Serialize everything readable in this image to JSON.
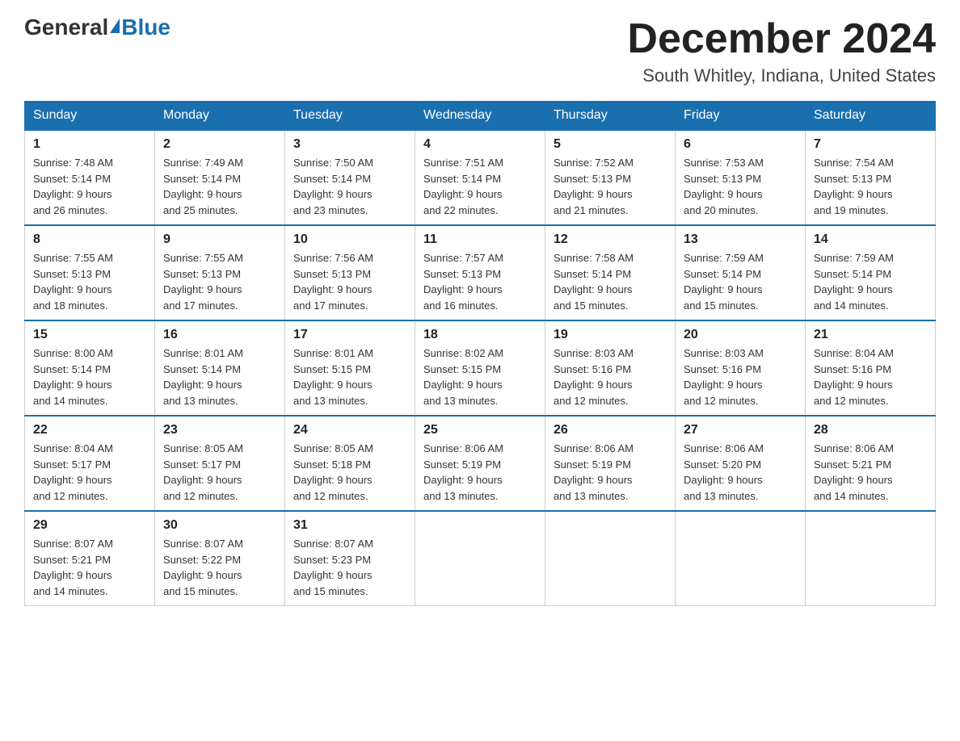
{
  "header": {
    "logo_general": "General",
    "logo_blue": "Blue",
    "month_title": "December 2024",
    "location": "South Whitley, Indiana, United States"
  },
  "days_of_week": [
    "Sunday",
    "Monday",
    "Tuesday",
    "Wednesday",
    "Thursday",
    "Friday",
    "Saturday"
  ],
  "weeks": [
    [
      {
        "day": "1",
        "sunrise": "7:48 AM",
        "sunset": "5:14 PM",
        "daylight": "9 hours and 26 minutes."
      },
      {
        "day": "2",
        "sunrise": "7:49 AM",
        "sunset": "5:14 PM",
        "daylight": "9 hours and 25 minutes."
      },
      {
        "day": "3",
        "sunrise": "7:50 AM",
        "sunset": "5:14 PM",
        "daylight": "9 hours and 23 minutes."
      },
      {
        "day": "4",
        "sunrise": "7:51 AM",
        "sunset": "5:14 PM",
        "daylight": "9 hours and 22 minutes."
      },
      {
        "day": "5",
        "sunrise": "7:52 AM",
        "sunset": "5:13 PM",
        "daylight": "9 hours and 21 minutes."
      },
      {
        "day": "6",
        "sunrise": "7:53 AM",
        "sunset": "5:13 PM",
        "daylight": "9 hours and 20 minutes."
      },
      {
        "day": "7",
        "sunrise": "7:54 AM",
        "sunset": "5:13 PM",
        "daylight": "9 hours and 19 minutes."
      }
    ],
    [
      {
        "day": "8",
        "sunrise": "7:55 AM",
        "sunset": "5:13 PM",
        "daylight": "9 hours and 18 minutes."
      },
      {
        "day": "9",
        "sunrise": "7:55 AM",
        "sunset": "5:13 PM",
        "daylight": "9 hours and 17 minutes."
      },
      {
        "day": "10",
        "sunrise": "7:56 AM",
        "sunset": "5:13 PM",
        "daylight": "9 hours and 17 minutes."
      },
      {
        "day": "11",
        "sunrise": "7:57 AM",
        "sunset": "5:13 PM",
        "daylight": "9 hours and 16 minutes."
      },
      {
        "day": "12",
        "sunrise": "7:58 AM",
        "sunset": "5:14 PM",
        "daylight": "9 hours and 15 minutes."
      },
      {
        "day": "13",
        "sunrise": "7:59 AM",
        "sunset": "5:14 PM",
        "daylight": "9 hours and 15 minutes."
      },
      {
        "day": "14",
        "sunrise": "7:59 AM",
        "sunset": "5:14 PM",
        "daylight": "9 hours and 14 minutes."
      }
    ],
    [
      {
        "day": "15",
        "sunrise": "8:00 AM",
        "sunset": "5:14 PM",
        "daylight": "9 hours and 14 minutes."
      },
      {
        "day": "16",
        "sunrise": "8:01 AM",
        "sunset": "5:14 PM",
        "daylight": "9 hours and 13 minutes."
      },
      {
        "day": "17",
        "sunrise": "8:01 AM",
        "sunset": "5:15 PM",
        "daylight": "9 hours and 13 minutes."
      },
      {
        "day": "18",
        "sunrise": "8:02 AM",
        "sunset": "5:15 PM",
        "daylight": "9 hours and 13 minutes."
      },
      {
        "day": "19",
        "sunrise": "8:03 AM",
        "sunset": "5:16 PM",
        "daylight": "9 hours and 12 minutes."
      },
      {
        "day": "20",
        "sunrise": "8:03 AM",
        "sunset": "5:16 PM",
        "daylight": "9 hours and 12 minutes."
      },
      {
        "day": "21",
        "sunrise": "8:04 AM",
        "sunset": "5:16 PM",
        "daylight": "9 hours and 12 minutes."
      }
    ],
    [
      {
        "day": "22",
        "sunrise": "8:04 AM",
        "sunset": "5:17 PM",
        "daylight": "9 hours and 12 minutes."
      },
      {
        "day": "23",
        "sunrise": "8:05 AM",
        "sunset": "5:17 PM",
        "daylight": "9 hours and 12 minutes."
      },
      {
        "day": "24",
        "sunrise": "8:05 AM",
        "sunset": "5:18 PM",
        "daylight": "9 hours and 12 minutes."
      },
      {
        "day": "25",
        "sunrise": "8:06 AM",
        "sunset": "5:19 PM",
        "daylight": "9 hours and 13 minutes."
      },
      {
        "day": "26",
        "sunrise": "8:06 AM",
        "sunset": "5:19 PM",
        "daylight": "9 hours and 13 minutes."
      },
      {
        "day": "27",
        "sunrise": "8:06 AM",
        "sunset": "5:20 PM",
        "daylight": "9 hours and 13 minutes."
      },
      {
        "day": "28",
        "sunrise": "8:06 AM",
        "sunset": "5:21 PM",
        "daylight": "9 hours and 14 minutes."
      }
    ],
    [
      {
        "day": "29",
        "sunrise": "8:07 AM",
        "sunset": "5:21 PM",
        "daylight": "9 hours and 14 minutes."
      },
      {
        "day": "30",
        "sunrise": "8:07 AM",
        "sunset": "5:22 PM",
        "daylight": "9 hours and 15 minutes."
      },
      {
        "day": "31",
        "sunrise": "8:07 AM",
        "sunset": "5:23 PM",
        "daylight": "9 hours and 15 minutes."
      },
      null,
      null,
      null,
      null
    ]
  ],
  "labels": {
    "sunrise": "Sunrise:",
    "sunset": "Sunset:",
    "daylight": "Daylight:"
  }
}
